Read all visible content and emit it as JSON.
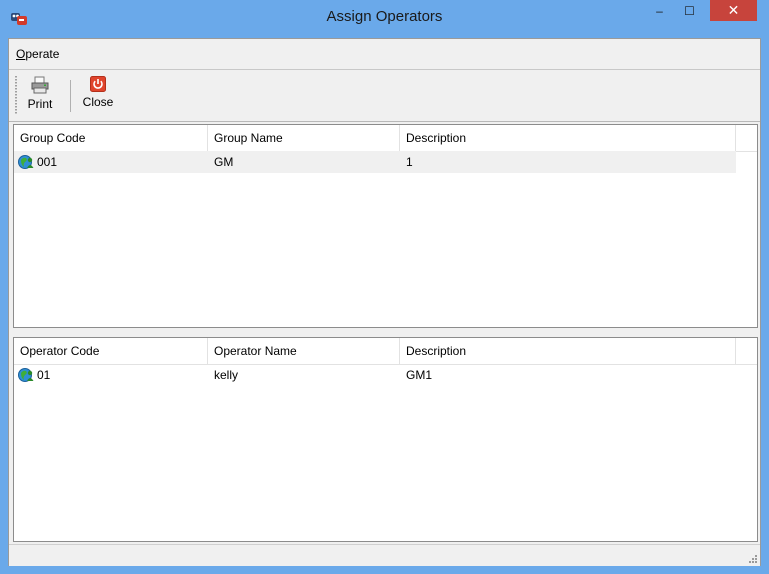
{
  "window": {
    "title": "Assign Operators",
    "accent_color": "#6aa9ea",
    "close_color": "#c7443c",
    "close_glyph": "✕",
    "minimize_glyph": "‒",
    "maximize_glyph": "☐"
  },
  "menu": {
    "operate_accel": "O",
    "operate_rest": "perate"
  },
  "toolbar": {
    "print_label": "Print",
    "close_label": "Close",
    "print_icon": "printer-icon",
    "close_icon": "power-icon"
  },
  "groups_grid": {
    "columns": [
      "Group Code",
      "Group Name",
      "Description"
    ],
    "rows": [
      {
        "code": "001",
        "name": "GM",
        "description": "1",
        "icon": "globe-users-icon"
      }
    ]
  },
  "operators_grid": {
    "columns": [
      "Operator Code",
      "Operator Name",
      "Description"
    ],
    "rows": [
      {
        "code": "01",
        "name": "kelly",
        "description": "GM1",
        "icon": "globe-users-icon"
      }
    ]
  }
}
